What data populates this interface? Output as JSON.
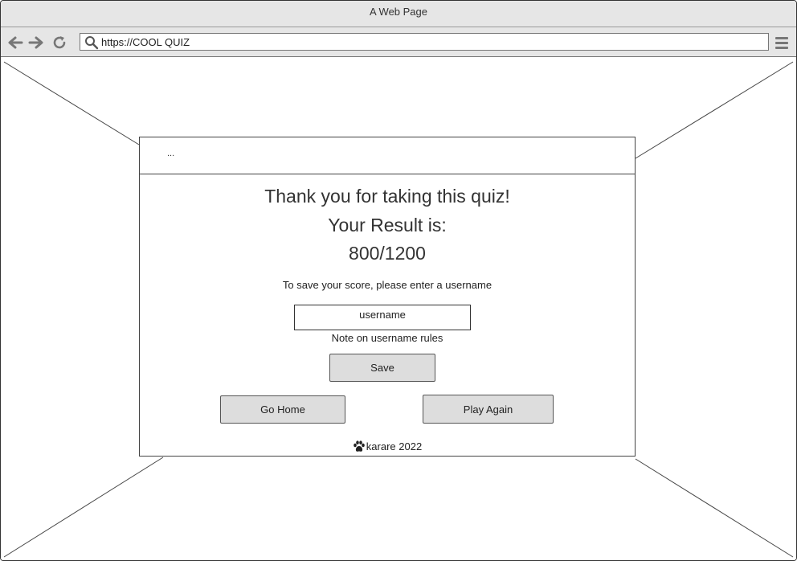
{
  "window": {
    "title": "A Web Page"
  },
  "address_bar": {
    "url": "https://COOL QUIZ"
  },
  "card": {
    "header_text": "...",
    "thank_you": "Thank you for taking this quiz!",
    "result_label": "Your Result is:",
    "score": "800/1200",
    "save_prompt": "To save your score, please enter a username",
    "username_placeholder": "username",
    "username_note": "Note on username rules",
    "save_label": "Save",
    "go_home_label": "Go Home",
    "play_again_label": "Play Again",
    "footer_text": "karare 2022"
  },
  "icons": {
    "back": "arrow-left-icon",
    "forward": "arrow-right-icon",
    "reload": "reload-icon",
    "search": "search-icon",
    "menu": "hamburger-menu-icon",
    "footer": "paw-icon"
  }
}
